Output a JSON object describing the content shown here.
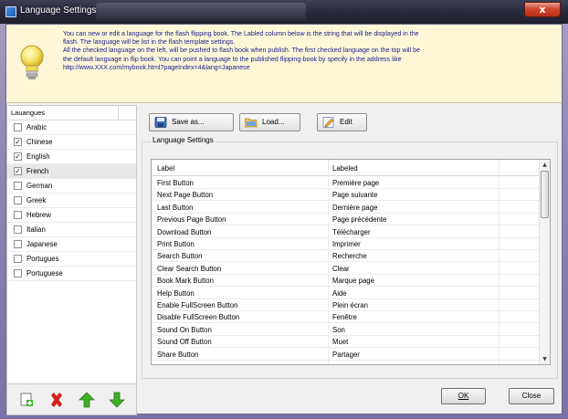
{
  "window": {
    "title": "Language Settings",
    "close_label": "x"
  },
  "info": {
    "text": "You can new or edit a language for the flash flipping book. The Labled column below is the string that will be displayed in the\nflash.  The language will be list in the flash template settings.\nAll the checked language on the left, will be pushed to flash book when publish.  The first checked language on the top will be\nthe default language in flip book. You can point a language to the published flipping-book by  specify in the address like\nhttp://www.XXX.com/mybook.html?pageIndex=4&lang=Japanese"
  },
  "languages": {
    "header": "Lauangues",
    "items": [
      {
        "label": "Arabic",
        "checked": false
      },
      {
        "label": "Chinese",
        "checked": true
      },
      {
        "label": "English",
        "checked": true
      },
      {
        "label": "French",
        "checked": true
      },
      {
        "label": "German",
        "checked": false
      },
      {
        "label": "Greek",
        "checked": false
      },
      {
        "label": "Hebrew",
        "checked": false
      },
      {
        "label": "Italian",
        "checked": false
      },
      {
        "label": "Japanese",
        "checked": false
      },
      {
        "label": "Portugues",
        "checked": false
      },
      {
        "label": "Portuguese",
        "checked": false
      }
    ],
    "check_mark": "✓"
  },
  "toolbar": {
    "save_label": "Save as...",
    "load_label": "Load...",
    "edit_label": "Edit"
  },
  "settings": {
    "group_label": "Language Settings",
    "columns": {
      "label": "Label",
      "labeled": "Labeled"
    },
    "rows": [
      {
        "label": "First Button",
        "labeled": "Première page"
      },
      {
        "label": "Next Page Button",
        "labeled": "Page suivante"
      },
      {
        "label": "Last Button",
        "labeled": "Dernière page"
      },
      {
        "label": "Previous Page Button",
        "labeled": "Page précédente"
      },
      {
        "label": "Download Button",
        "labeled": "Télécharger"
      },
      {
        "label": "Print Button",
        "labeled": "Imprimer"
      },
      {
        "label": "Search Button",
        "labeled": "Recherche"
      },
      {
        "label": "Clear Search Button",
        "labeled": "Clear"
      },
      {
        "label": "Book Mark Button",
        "labeled": "Marque page"
      },
      {
        "label": "Help Button",
        "labeled": "Aide"
      },
      {
        "label": "Enable FullScreen Button",
        "labeled": "Plein écran"
      },
      {
        "label": "Disable FullScreen Button",
        "labeled": "Fenêtre"
      },
      {
        "label": "Sound On Button",
        "labeled": "Son"
      },
      {
        "label": "Sound Off Button",
        "labeled": "Muet"
      },
      {
        "label": "Share Button",
        "labeled": "Partager"
      }
    ]
  },
  "footer": {
    "ok_label": "OK",
    "close_label": "Close"
  },
  "colors": {
    "info_bg": "#fdf7d8",
    "info_text": "#1a1a8a",
    "close_red": "#d0472f",
    "add_green": "#3fae2a",
    "delete_red": "#d4201a"
  }
}
